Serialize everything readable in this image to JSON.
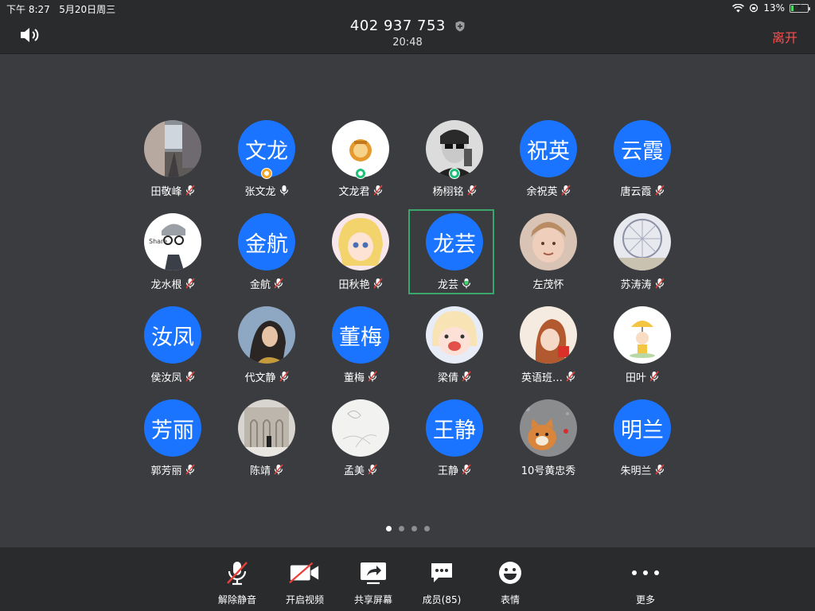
{
  "status": {
    "time": "下午 8:27",
    "date": "5月20日周三",
    "battery_text": "13%",
    "battery_level": 0.13
  },
  "header": {
    "meeting_id": "402 937 753",
    "duration": "20:48",
    "leave_label": "离开"
  },
  "colors": {
    "accent": "#1a74ff",
    "leave": "#ff4d4f",
    "active_frame": "#3ba56a",
    "host_badge": "#f5a623",
    "cohost_badge": "#21c07a"
  },
  "participants": [
    {
      "name": "田敬峰",
      "avatar_text": "",
      "photo": "street-photo",
      "mic": "muted"
    },
    {
      "name": "张文龙",
      "avatar_text": "文龙",
      "photo": "",
      "mic": "on",
      "badge": "host"
    },
    {
      "name": "文龙君",
      "avatar_text": "",
      "photo": "emblem-photo",
      "mic": "muted",
      "badge": "cohost"
    },
    {
      "name": "杨栩铭",
      "avatar_text": "",
      "photo": "portrait-bw-photo",
      "mic": "muted",
      "badge": "cohost"
    },
    {
      "name": "余祝英",
      "avatar_text": "祝英",
      "photo": "",
      "mic": "muted"
    },
    {
      "name": "唐云霞",
      "avatar_text": "云霞",
      "photo": "",
      "mic": "muted"
    },
    {
      "name": "龙水根",
      "avatar_text": "",
      "photo": "cartoon-glasses-photo",
      "mic": "muted"
    },
    {
      "name": "金航",
      "avatar_text": "金航",
      "photo": "",
      "mic": "muted"
    },
    {
      "name": "田秋艳",
      "avatar_text": "",
      "photo": "anime-girl-photo",
      "mic": "muted"
    },
    {
      "name": "龙芸",
      "avatar_text": "龙芸",
      "photo": "",
      "mic": "speaking",
      "active": true
    },
    {
      "name": "左茂怀",
      "avatar_text": "",
      "photo": "child-photo",
      "mic": "none"
    },
    {
      "name": "苏涛涛",
      "avatar_text": "",
      "photo": "ferris-wheel-photo",
      "mic": "muted"
    },
    {
      "name": "侯汝凤",
      "avatar_text": "汝凤",
      "photo": "",
      "mic": "muted"
    },
    {
      "name": "代文静",
      "avatar_text": "",
      "photo": "woman-photo",
      "mic": "muted"
    },
    {
      "name": "董梅",
      "avatar_text": "董梅",
      "photo": "",
      "mic": "muted"
    },
    {
      "name": "梁倩",
      "avatar_text": "",
      "photo": "cartoon-girl-photo",
      "mic": "muted"
    },
    {
      "name": "英语班…",
      "avatar_text": "",
      "photo": "illustration-girl-photo",
      "mic": "muted"
    },
    {
      "name": "田叶",
      "avatar_text": "",
      "photo": "cartoon-umbrella-photo",
      "mic": "muted"
    },
    {
      "name": "郭芳丽",
      "avatar_text": "芳丽",
      "photo": "",
      "mic": "muted"
    },
    {
      "name": "陈靖",
      "avatar_text": "",
      "photo": "building-photo",
      "mic": "muted"
    },
    {
      "name": "孟美",
      "avatar_text": "",
      "photo": "sketch-photo",
      "mic": "muted"
    },
    {
      "name": "王静",
      "avatar_text": "王静",
      "photo": "",
      "mic": "muted"
    },
    {
      "name": "10号黄忠秀",
      "avatar_text": "",
      "photo": "cat-photo",
      "mic": "none"
    },
    {
      "name": "朱明兰",
      "avatar_text": "明兰",
      "photo": "",
      "mic": "muted"
    }
  ],
  "pagination": {
    "pages": 4,
    "current": 1
  },
  "toolbar": {
    "unmute_label": "解除静音",
    "video_label": "开启视频",
    "share_label": "共享屏幕",
    "members_label": "成员(85)",
    "reaction_label": "表情",
    "more_label": "更多"
  }
}
